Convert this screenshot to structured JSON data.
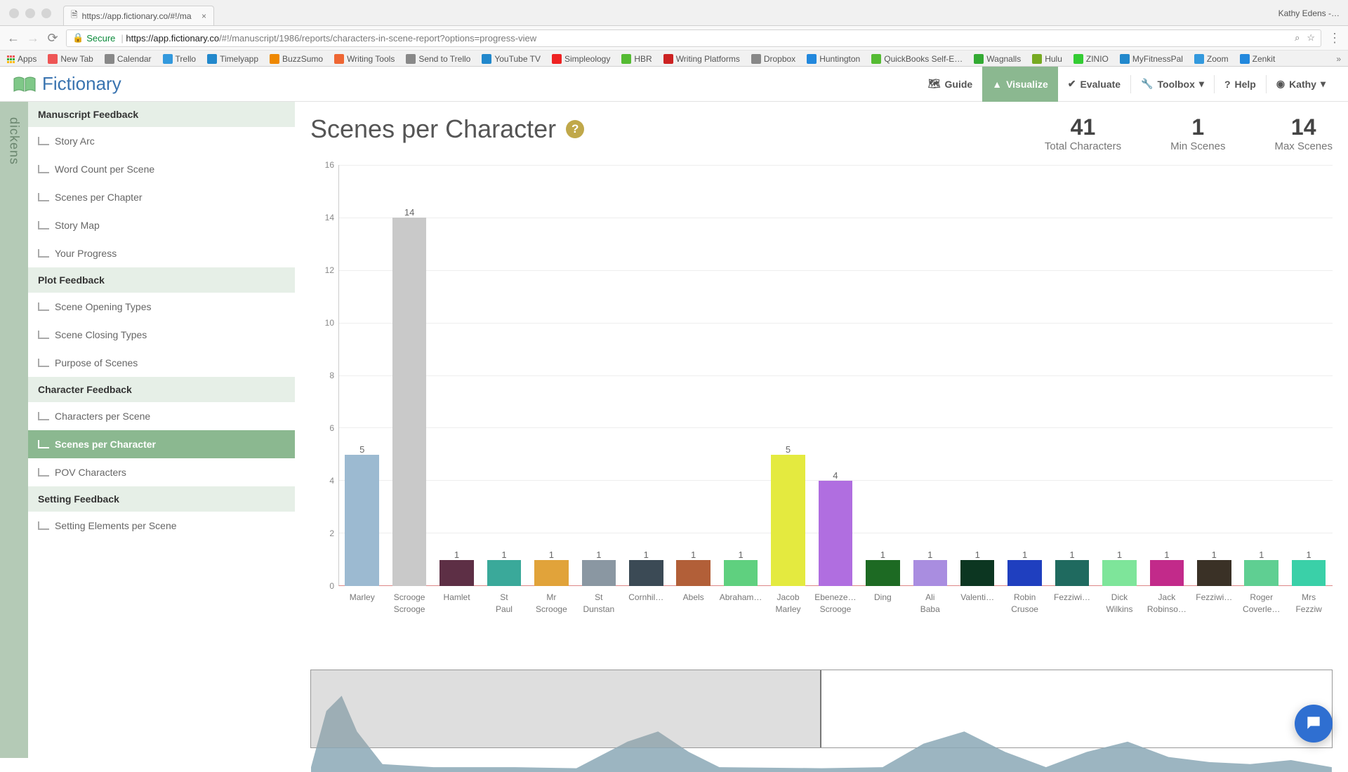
{
  "browser": {
    "user": "Kathy Edens -…",
    "tab_title": "https://app.fictionary.co/#!/ma",
    "secure": "Secure",
    "url_host": "https://app.fictionary.co",
    "url_path": "/#!/manuscript/1986/reports/characters-in-scene-report?options=progress-view",
    "bookmarks": [
      "Apps",
      "New Tab",
      "Calendar",
      "Trello",
      "Timelyapp",
      "BuzzSumo",
      "Writing Tools",
      "Send to Trello",
      "YouTube TV",
      "Simpleology",
      "HBR",
      "Writing Platforms",
      "Dropbox",
      "Huntington",
      "QuickBooks Self-E…",
      "Wagnalls",
      "Hulu",
      "ZINIO",
      "MyFitnessPal",
      "Zoom",
      "Zenkit"
    ]
  },
  "logo_text": "Fictionary",
  "header": {
    "guide": "Guide",
    "visualize": "Visualize",
    "evaluate": "Evaluate",
    "toolbox": "Toolbox",
    "help": "Help",
    "user": "Kathy"
  },
  "rail": "dickens",
  "sidebar": {
    "g1": "Manuscript Feedback",
    "g1_items": [
      "Story Arc",
      "Word Count per Scene",
      "Scenes per Chapter",
      "Story Map",
      "Your Progress"
    ],
    "g2": "Plot Feedback",
    "g2_items": [
      "Scene Opening Types",
      "Scene Closing Types",
      "Purpose of Scenes"
    ],
    "g3": "Character Feedback",
    "g3_items": [
      "Characters per Scene",
      "Scenes per Character",
      "POV Characters"
    ],
    "g4": "Setting Feedback",
    "g4_items": [
      "Setting Elements per Scene"
    ]
  },
  "title": "Scenes per Character",
  "stats": [
    {
      "val": "41",
      "lbl": "Total Characters"
    },
    {
      "val": "1",
      "lbl": "Min Scenes"
    },
    {
      "val": "14",
      "lbl": "Max Scenes"
    }
  ],
  "chart_data": {
    "type": "bar",
    "title": "Scenes per Character",
    "ylabel": "",
    "xlabel": "",
    "ylim": [
      0,
      16
    ],
    "y_ticks": [
      0,
      2,
      4,
      6,
      8,
      10,
      12,
      14,
      16
    ],
    "categories": [
      "Marley",
      "Scrooge Scrooge",
      "Hamlet",
      "St Paul",
      "Mr Scrooge",
      "St Dunstan",
      "Cornhil…",
      "Abels",
      "Abraham…",
      "Jacob Marley",
      "Ebeneze… Scrooge",
      "Ding",
      "Ali Baba",
      "Valenti…",
      "Robin Crusoe",
      "Fezziwi…",
      "Dick Wilkins",
      "Jack Robinso…",
      "Fezziwi…",
      "Roger Coverle…",
      "Mrs Fezziw"
    ],
    "values": [
      5,
      14,
      1,
      1,
      1,
      1,
      1,
      1,
      1,
      5,
      4,
      1,
      1,
      1,
      1,
      1,
      1,
      1,
      1,
      1,
      1
    ],
    "colors": [
      "#9cbad1",
      "#c9c9c9",
      "#5d2f45",
      "#3aa99a",
      "#e1a33a",
      "#8a97a2",
      "#3b4a55",
      "#b25f38",
      "#5fd07f",
      "#e4ea3f",
      "#b06ee0",
      "#1d6a23",
      "#a98de0",
      "#0c3621",
      "#1f3fbf",
      "#1f6a5f",
      "#7ee59a",
      "#c22a8a",
      "#3a3126",
      "#5fcf92",
      "#3ad0a8"
    ]
  }
}
